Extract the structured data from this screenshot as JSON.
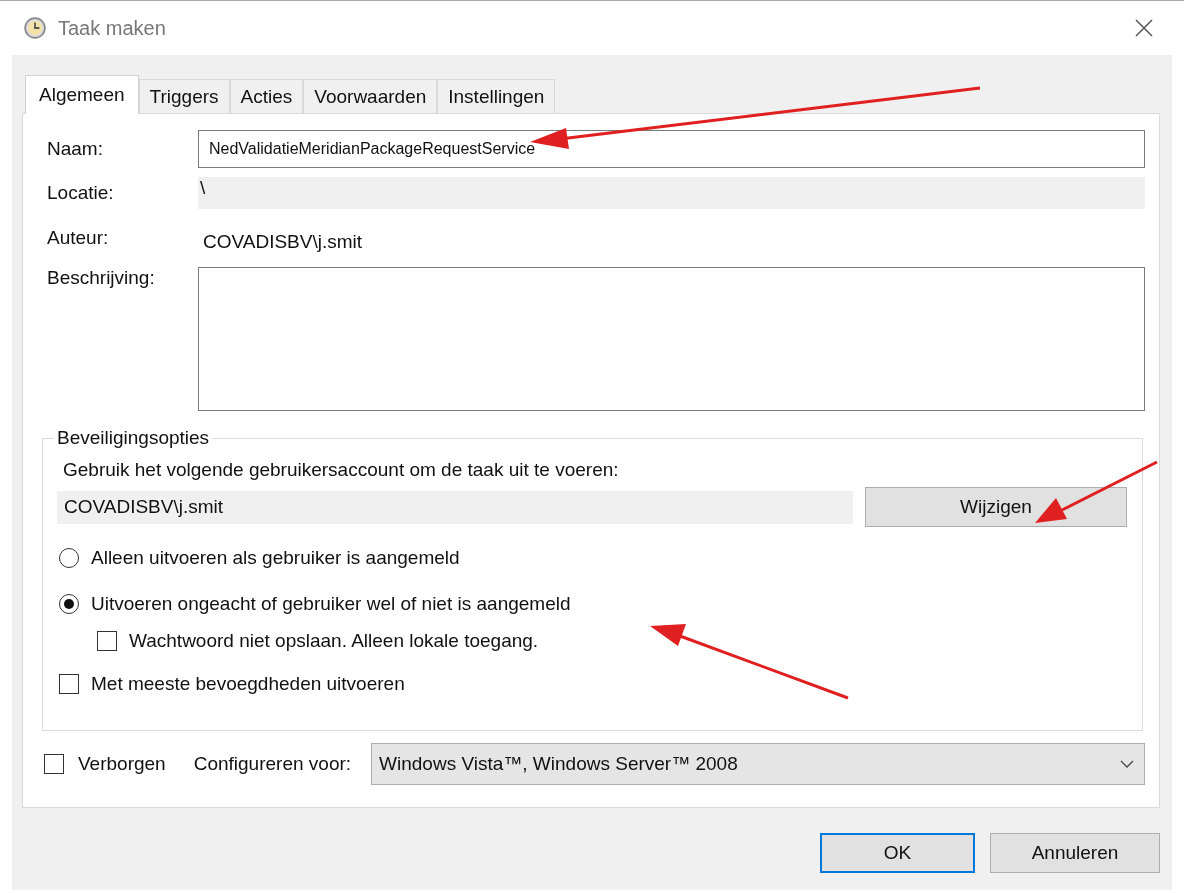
{
  "window": {
    "title": "Taak maken"
  },
  "tabs": [
    {
      "label": "Algemeen",
      "selected": true
    },
    {
      "label": "Triggers",
      "selected": false
    },
    {
      "label": "Acties",
      "selected": false
    },
    {
      "label": "Voorwaarden",
      "selected": false
    },
    {
      "label": "Instellingen",
      "selected": false
    }
  ],
  "general": {
    "name": {
      "label": "Naam:",
      "value": "NedValidatieMeridianPackageRequestService"
    },
    "location": {
      "label": "Locatie:",
      "value": "\\"
    },
    "author": {
      "label": "Auteur:",
      "value": "COVADISBV\\j.smit"
    },
    "description": {
      "label": "Beschrijving:"
    }
  },
  "security": {
    "title": "Beveiligingsopties",
    "prompt": "Gebruik het volgende gebruikersaccount om de taak uit te voeren:",
    "account": "COVADISBV\\j.smit",
    "change_button": "Wijzigen",
    "options": [
      {
        "kind": "radio",
        "label": "Alleen uitvoeren als gebruiker is aangemeld",
        "selected": false
      },
      {
        "kind": "radio",
        "label": "Uitvoeren ongeacht of gebruiker wel of niet is aangemeld",
        "selected": true,
        "children": [
          {
            "kind": "checkbox",
            "label": "Wachtwoord niet opslaan. Alleen lokale toegang.",
            "checked": false
          }
        ]
      },
      {
        "kind": "checkbox",
        "label": "Met meeste bevoegdheden uitvoeren",
        "checked": false
      }
    ]
  },
  "hidden": {
    "label": "Verborgen",
    "checked": false
  },
  "configure": {
    "label": "Configureren voor:",
    "value": "Windows Vista™, Windows Server™ 2008"
  },
  "buttons": [
    {
      "label": "OK",
      "default": true
    },
    {
      "label": "Annuleren",
      "default": false
    }
  ]
}
